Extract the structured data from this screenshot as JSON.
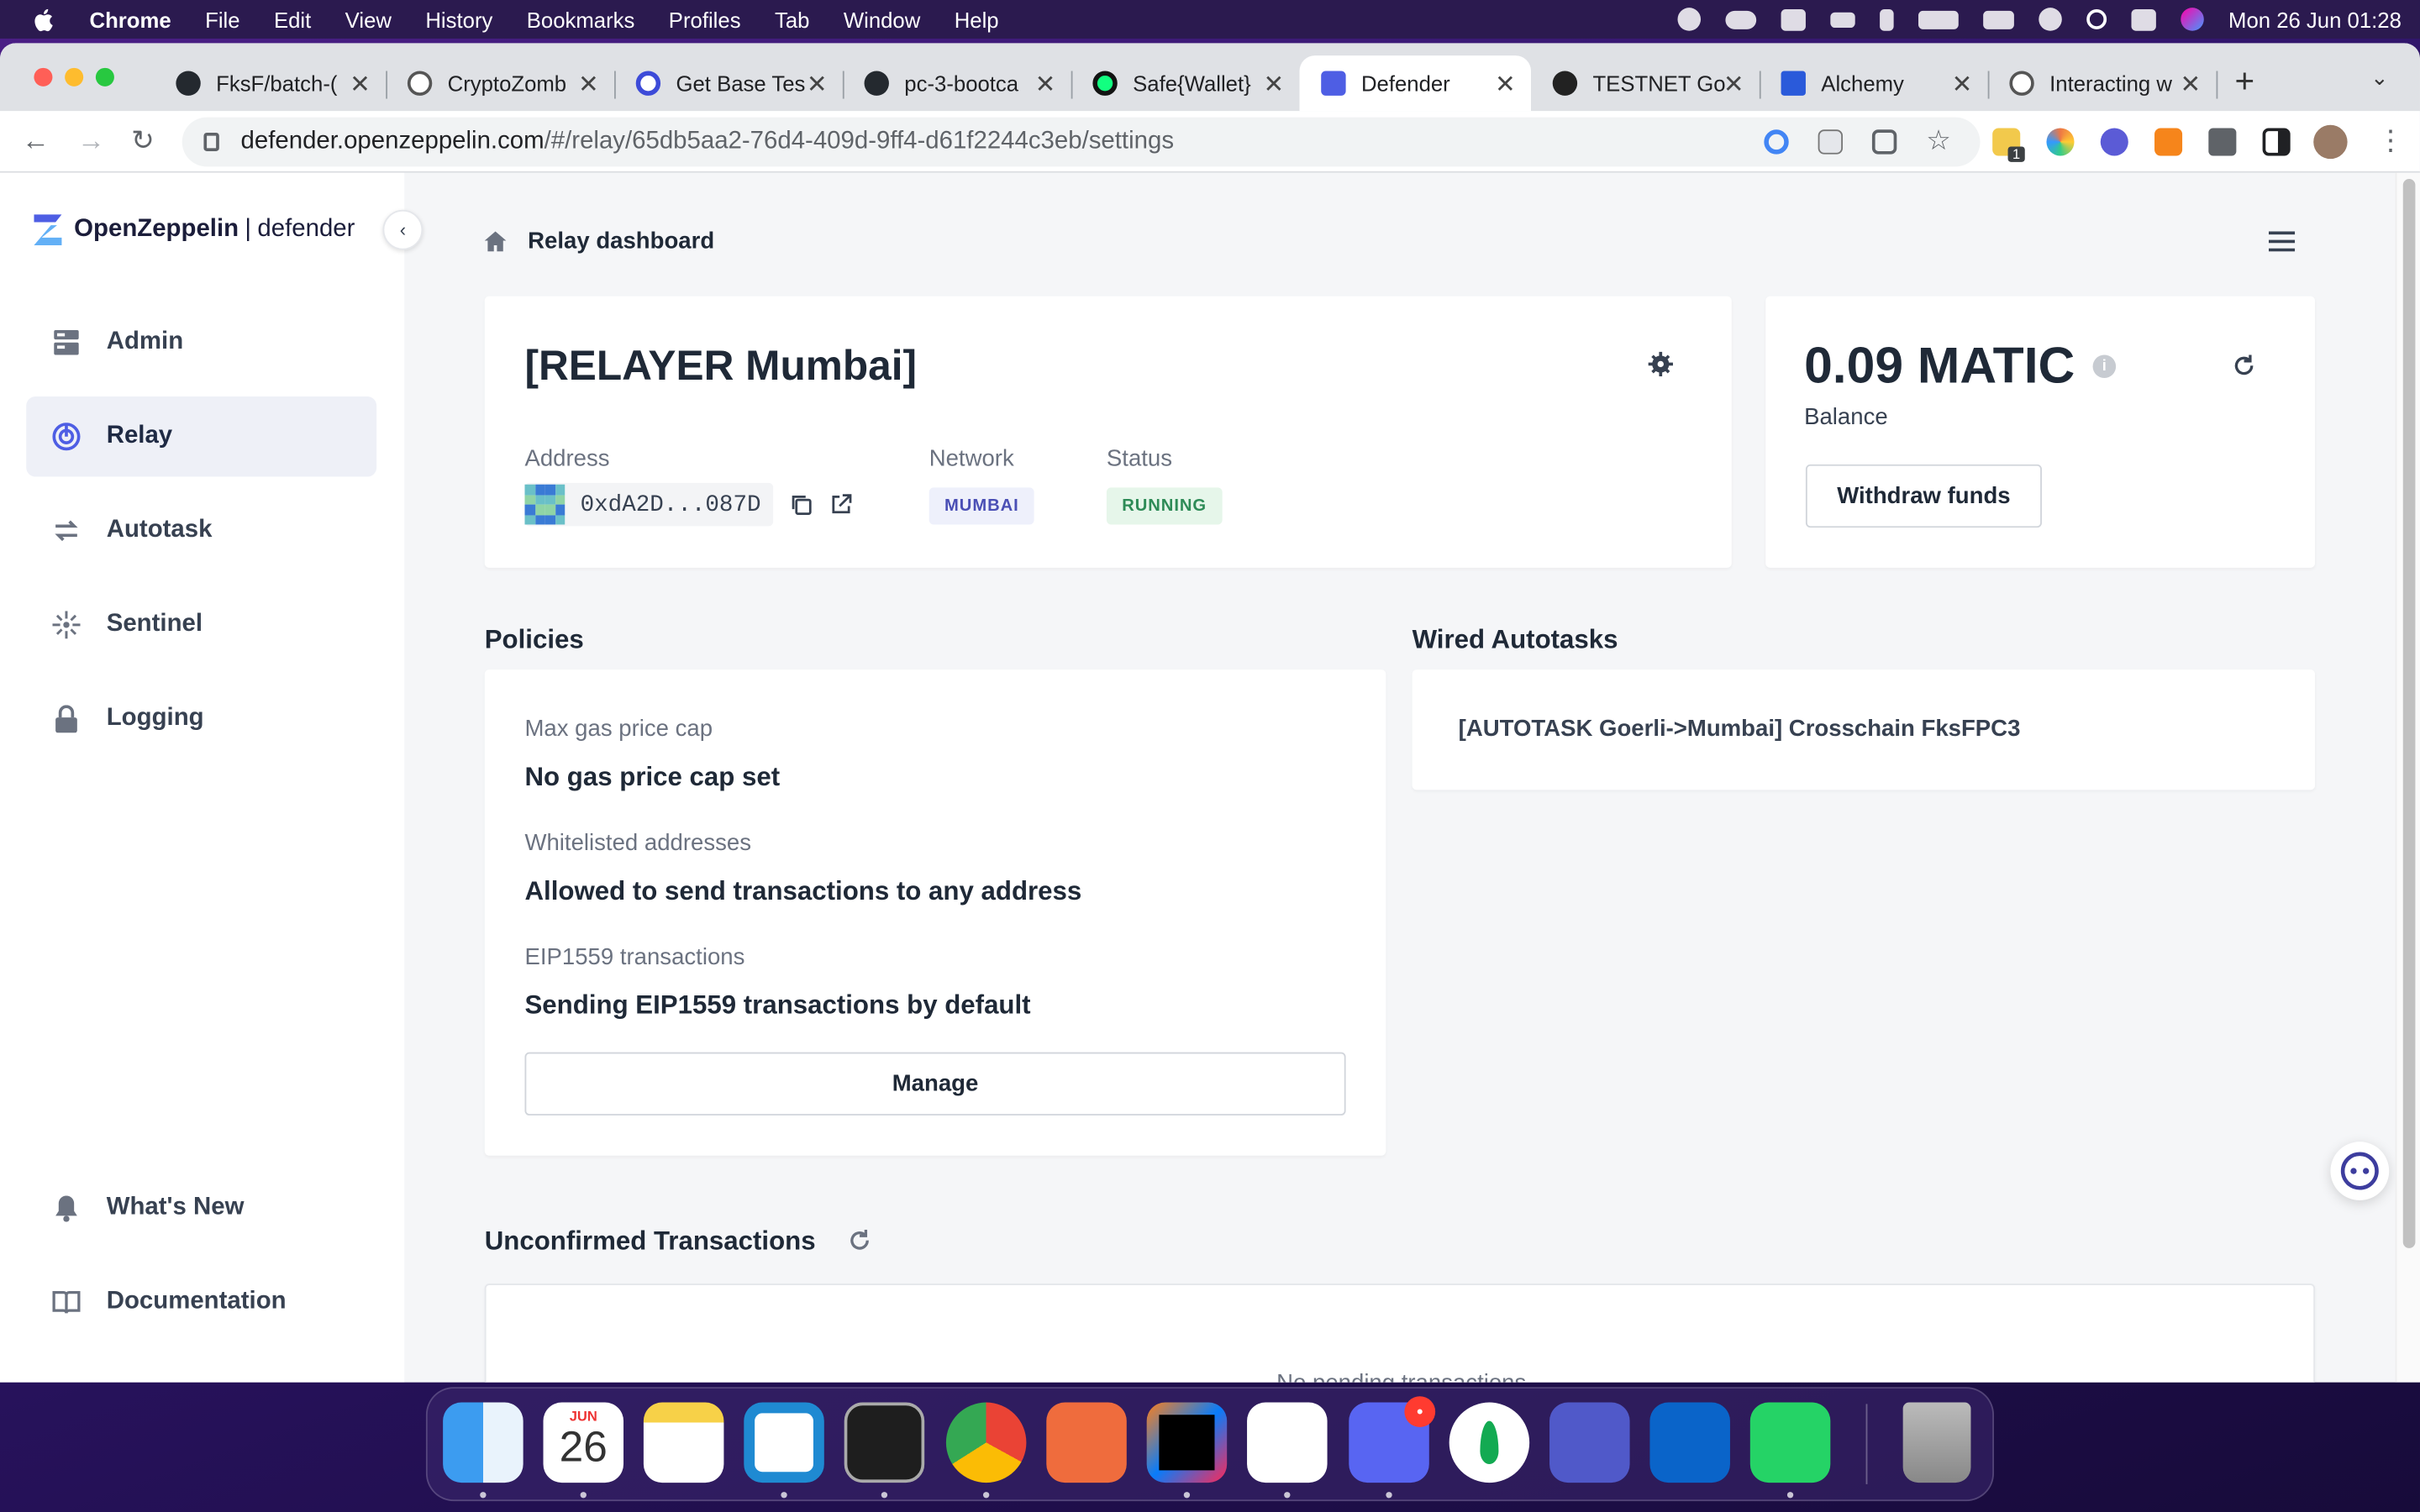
{
  "menubar": {
    "app_name": "Chrome",
    "items": [
      "File",
      "Edit",
      "View",
      "History",
      "Bookmarks",
      "Profiles",
      "Tab",
      "Window",
      "Help"
    ],
    "clock": "Mon 26 Jun  01:28"
  },
  "tabs": [
    {
      "title": "FksF/batch-(",
      "icon": "github-icon"
    },
    {
      "title": "CryptoZomb",
      "icon": "globe-icon"
    },
    {
      "title": "Get Base Tes",
      "icon": "base-icon"
    },
    {
      "title": "pc-3-bootca",
      "icon": "github-icon"
    },
    {
      "title": "Safe{Wallet}",
      "icon": "safe-icon"
    },
    {
      "title": "Defender",
      "icon": "openzeppelin-icon",
      "active": true
    },
    {
      "title": "TESTNET Go",
      "icon": "testnet-icon"
    },
    {
      "title": "Alchemy",
      "icon": "alchemy-icon"
    },
    {
      "title": "Interacting w",
      "icon": "globe-icon"
    }
  ],
  "address_bar": {
    "domain": "defender.openzeppelin.com",
    "path": "/#/relay/65db5aa2-76d4-409d-9ff4-d61f2244c3eb/settings"
  },
  "extension_badge": "1",
  "sidebar": {
    "brand": "OpenZeppelin",
    "product_separator": "|",
    "product": "defender",
    "items": [
      {
        "label": "Admin",
        "icon": "admin-icon"
      },
      {
        "label": "Relay",
        "icon": "relay-icon",
        "active": true
      },
      {
        "label": "Autotask",
        "icon": "autotask-icon"
      },
      {
        "label": "Sentinel",
        "icon": "sentinel-icon"
      },
      {
        "label": "Logging",
        "icon": "lock-icon"
      }
    ],
    "footer_items": [
      {
        "label": "What's New",
        "icon": "bell-icon"
      },
      {
        "label": "Documentation",
        "icon": "book-icon"
      }
    ]
  },
  "breadcrumb": {
    "label": "Relay dashboard"
  },
  "relayer": {
    "name": "[RELAYER Mumbai]",
    "address_label": "Address",
    "address": "0xdA2D...087D",
    "network_label": "Network",
    "network": "MUMBAI",
    "status_label": "Status",
    "status": "RUNNING"
  },
  "balance": {
    "amount": "0.09 MATIC",
    "label": "Balance",
    "info_glyph": "i",
    "withdraw_label": "Withdraw funds"
  },
  "policies": {
    "title": "Policies",
    "items": [
      {
        "label": "Max gas price cap",
        "value": "No gas price cap set"
      },
      {
        "label": "Whitelisted addresses",
        "value": "Allowed to send transactions to any address"
      },
      {
        "label": "EIP1559 transactions",
        "value": "Sending EIP1559 transactions by default"
      }
    ],
    "manage_label": "Manage"
  },
  "wired_autotasks": {
    "title": "Wired Autotasks",
    "items": [
      "[AUTOTASK Goerli->Mumbai] Crosschain FksFPC3"
    ]
  },
  "unconfirmed": {
    "title": "Unconfirmed Transactions",
    "empty_text": "No pending transactions"
  },
  "dock": {
    "calendar_month": "JUN",
    "calendar_day": "26",
    "discord_badge": "•",
    "apps": [
      "Finder",
      "Calendar",
      "Notes",
      "Visual Studio Code",
      "Terminal",
      "Chrome",
      "Postman",
      "IntelliJ IDEA",
      "Slack",
      "Discord",
      "MongoDB Compass",
      "Microsoft Teams",
      "Outlook",
      "WhatsApp",
      "Trash"
    ]
  },
  "colors": {
    "accent": "#4e5ee4",
    "network_badge_bg": "#eef0fb",
    "network_badge_text": "#4a4fb5",
    "status_badge_bg": "#e6f6ea",
    "status_badge_text": "#2e8b57"
  }
}
